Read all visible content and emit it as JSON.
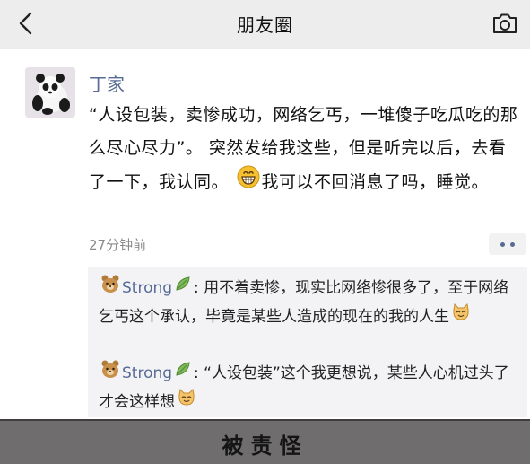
{
  "navbar": {
    "title": "朋友圈",
    "back_icon": "chevron-left-icon",
    "camera_icon": "camera-icon"
  },
  "post": {
    "author": "丁家",
    "text_before_emoji": "“人设包装，卖惨成功，网络乞丐，一堆傻子吃瓜吃的那么尽心尽力”。 突然发给我这些，但是听完以后，去看了一下，我认同。 ",
    "emoji": "grinning-face-emoji",
    "text_after_emoji": "我可以不回消息了吗，睡觉。",
    "time": "27分钟前"
  },
  "comments": [
    {
      "name": "Strong",
      "text": ": 用不着卖惨，现实比网络惨很多了，至于网络乞丐这个承认，毕竟是某些人造成的现在的我的人生",
      "icons": [
        "bear-icon",
        "leaf-icon",
        "cat-face-emoji"
      ]
    },
    {
      "name": "Strong",
      "text": ": “人设包装”这个我更想说，某些人心机过头了才会这样想",
      "icons": [
        "bear-icon",
        "leaf-icon",
        "cat-face-emoji"
      ]
    }
  ],
  "caption": {
    "text": "被责怪"
  },
  "colors": {
    "link": "#576b95",
    "navbar_bg": "#ededed",
    "comment_bg": "#f3f3f5",
    "caption_bg": "#6f6d6d"
  }
}
